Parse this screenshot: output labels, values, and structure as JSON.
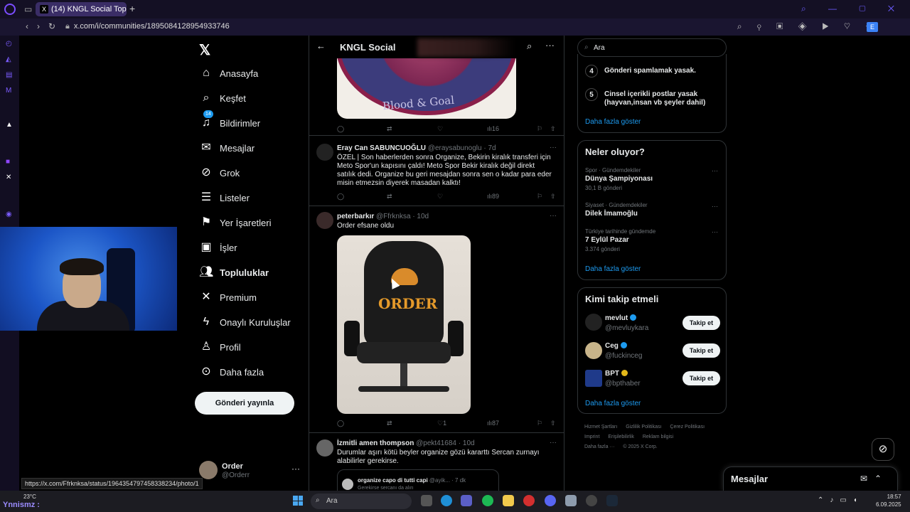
{
  "browser": {
    "tab_title": "(14) KNGL Social Topluluk",
    "url": "x.com/i/communities/1895084128954933746",
    "extension_letter": "E",
    "status_url": "https://x.com/Ffrknksa/status/1964354797458338234/photo/1"
  },
  "x_nav": {
    "items": [
      {
        "label": "Anasayfa",
        "icon": "home-icon"
      },
      {
        "label": "Keşfet",
        "icon": "search-icon"
      },
      {
        "label": "Bildirimler",
        "icon": "bell-icon",
        "badge": "14"
      },
      {
        "label": "Mesajlar",
        "icon": "mail-icon"
      },
      {
        "label": "Grok",
        "icon": "grok-icon"
      },
      {
        "label": "Listeler",
        "icon": "list-icon"
      },
      {
        "label": "Yer İşaretleri",
        "icon": "bookmark-icon"
      },
      {
        "label": "İşler",
        "icon": "briefcase-icon"
      },
      {
        "label": "Topluluklar",
        "icon": "communities-icon"
      },
      {
        "label": "Premium",
        "icon": "x-icon"
      },
      {
        "label": "Onaylı Kuruluşlar",
        "icon": "lightning-icon"
      },
      {
        "label": "Profil",
        "icon": "person-icon"
      },
      {
        "label": "Daha fazla",
        "icon": "more-circle-icon"
      }
    ],
    "post_button": "Gönderi yayınla",
    "account": {
      "name": "Order",
      "handle": "@Orderr"
    }
  },
  "main": {
    "title": "KNGL Social",
    "top_image_text": "Blood & Goal",
    "top_actions": {
      "views": "16"
    },
    "tweets": [
      {
        "name": "Eray Can SABUNCUOĞLU",
        "handle": "@eraysabunoglu",
        "time": "· 7d",
        "text": "ÖZEL | Son haberlerden sonra Organize, Bekirin kiralık transferi için Meto Spor'un kapısını çaldı! Meto Spor Bekir kiralık değil direkt satılık dedi. Organize bu geri mesajdan sonra sen o kadar para eder misin etmezsin diyerek masadan kalktı!",
        "views": "89"
      },
      {
        "name": "peterbarkır",
        "handle": "@Ffrknksa",
        "time": "· 10d",
        "text": "Order efsane oldu",
        "image_text": "ORDER",
        "likes": "1",
        "views": "87"
      },
      {
        "name": "İzmitli amen thompson",
        "handle": "@pekt41684",
        "time": "· 10d",
        "text": "Durumlar aşırı kötü beyler organize gözü kararttı Sercan zurnayı alabilirler gerekirse.",
        "quote_name": "organize capo di tutti capi",
        "quote_handle": "@ayik... · 7 dk",
        "quote_text": "Gerekirse sercanı da alırı"
      }
    ]
  },
  "right": {
    "search_placeholder": "Ara",
    "rules": [
      {
        "num": "4",
        "text": "Gönderi spamlamak yasak."
      },
      {
        "num": "5",
        "text": "Cinsel içerikli postlar yasak (hayvan,insan vb şeyler dahil)"
      }
    ],
    "show_more": "Daha fazla göster",
    "trends_title": "Neler oluyor?",
    "trends": [
      {
        "context": "Spor · Gündemdekiler",
        "title": "Dünya Şampiyonası",
        "count": "30,1 B gönderi"
      },
      {
        "context": "Siyaset · Gündemdekiler",
        "title": "Dilek İmamoğlu",
        "count": ""
      },
      {
        "context": "Türkiye tarihinde gündemde",
        "title": "7 Eylül Pazar",
        "count": "3.374 gönderi"
      }
    ],
    "who_title": "Kimi takip etmeli",
    "who": [
      {
        "name": "mevlut",
        "handle": "@mevluykara",
        "verified": "blue"
      },
      {
        "name": "Ceg",
        "handle": "@fuckinceg",
        "verified": "blue"
      },
      {
        "name": "BPT",
        "handle": "@bpthaber",
        "verified": "gold"
      }
    ],
    "follow_label": "Takip et",
    "footer": [
      "Hizmet Şartları",
      "Gizlilik Politikası",
      "Çerez Politikası",
      "Imprint",
      "Erişilebilirlik",
      "Reklam bilgisi",
      "Daha fazla ···",
      "© 2025 X Corp."
    ]
  },
  "messages_drawer": {
    "title": "Mesajlar"
  },
  "taskbar": {
    "weather": "23°C",
    "stream_label": "Ynnismz :",
    "search_placeholder": "Ara",
    "time": "18:57",
    "date": "6.09.2025"
  }
}
